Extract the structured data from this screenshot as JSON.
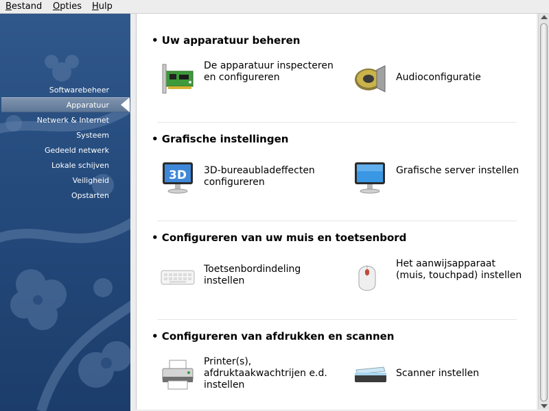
{
  "menubar": {
    "items": [
      {
        "first": "B",
        "rest": "estand"
      },
      {
        "first": "O",
        "rest": "pties"
      },
      {
        "first": "H",
        "rest": "ulp"
      }
    ]
  },
  "sidebar": {
    "items": [
      {
        "label": "Softwarebeheer"
      },
      {
        "label": "Apparatuur",
        "selected": true
      },
      {
        "label": "Netwerk & Internet"
      },
      {
        "label": "Systeem"
      },
      {
        "label": "Gedeeld netwerk"
      },
      {
        "label": "Lokale schijven"
      },
      {
        "label": "Veiligheid"
      },
      {
        "label": "Opstarten"
      }
    ]
  },
  "sections": [
    {
      "title": "• Uw apparatuur beheren",
      "tools": [
        {
          "label": "De apparatuur inspecteren en configureren",
          "icon": "pci-card-icon"
        },
        {
          "label": "Audioconfiguratie",
          "icon": "speaker-icon"
        }
      ]
    },
    {
      "title": "• Grafische instellingen",
      "tools": [
        {
          "label": "3D-bureaubladeffecten configureren",
          "icon": "3d-monitor-icon"
        },
        {
          "label": "Grafische server instellen",
          "icon": "monitor-icon"
        }
      ]
    },
    {
      "title": "• Configureren van uw muis en toetsenbord",
      "tools": [
        {
          "label": "Toetsenbordindeling instellen",
          "icon": "keyboard-icon"
        },
        {
          "label": "Het aanwijsapparaat (muis, touchpad) instellen",
          "icon": "mouse-icon"
        }
      ]
    },
    {
      "title": "• Configureren van afdrukken en scannen",
      "tools": [
        {
          "label": "Printer(s), afdruktaakwachtrijen e.d. instellen",
          "icon": "printer-icon"
        },
        {
          "label": "Scanner instellen",
          "icon": "scanner-icon"
        }
      ]
    }
  ]
}
